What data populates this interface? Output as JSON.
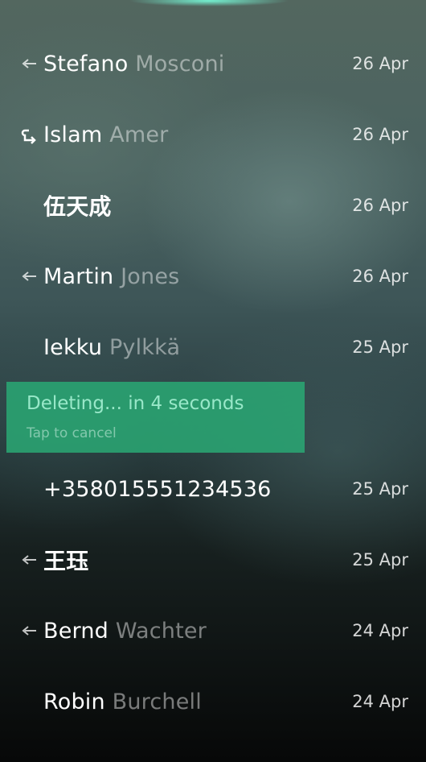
{
  "conversations": [
    {
      "first": "Stefano",
      "last": "Mosconi",
      "date": "26 Apr",
      "indicator": "outgoing-arrow-icon"
    },
    {
      "first": "Islam",
      "last": "Amer",
      "date": "26 Apr",
      "indicator": "reply-arrow-icon"
    },
    {
      "first": "伍天成",
      "last": "",
      "date": "26 Apr",
      "indicator": ""
    },
    {
      "first": "Martin",
      "last": "Jones",
      "date": "26 Apr",
      "indicator": "outgoing-arrow-icon"
    },
    {
      "first": "Iekku",
      "last": "Pylkkä",
      "date": "25 Apr",
      "indicator": ""
    },
    {
      "first": "+358015551234536",
      "last": "",
      "date": "25 Apr",
      "indicator": ""
    },
    {
      "first": "王珏",
      "last": "",
      "date": "25 Apr",
      "indicator": "outgoing-arrow-icon"
    },
    {
      "first": "Bernd",
      "last": "Wachter",
      "date": "24 Apr",
      "indicator": "outgoing-arrow-icon"
    },
    {
      "first": "Robin",
      "last": "Burchell",
      "date": "24 Apr",
      "indicator": ""
    }
  ],
  "remorse": {
    "title": "Deleting... in 4 seconds",
    "subtitle": "Tap to cancel"
  },
  "colors": {
    "accent": "#2aa673",
    "highlight_text": "#a8ffdb"
  }
}
